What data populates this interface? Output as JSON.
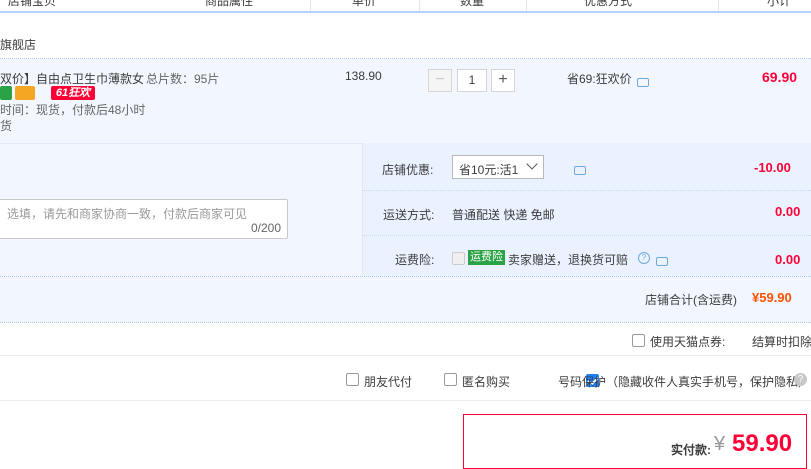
{
  "header": {
    "columns": [
      "店铺宝贝",
      "商品属性",
      "单价",
      "数量",
      "优惠方式",
      "小计"
    ]
  },
  "shop": {
    "name": "旗舰店"
  },
  "item": {
    "title": "双价】自由点卫生巾薄款女...",
    "attr": "总片数：95片",
    "tag_label": "61狂欢",
    "delivery": "时间：现货，付款后48小时",
    "delivery2": "货",
    "price": "138.90",
    "quantity": "1",
    "promo": "省69:狂欢价",
    "subtotal": "69.90"
  },
  "message": {
    "placeholder": "选填，请先和商家协商一致，付款后商家可见",
    "counter": "0/200"
  },
  "shop_discount": {
    "label": "店铺优惠:",
    "selected": "省10元:活1",
    "amount": "-10.00"
  },
  "shipping": {
    "label": "运送方式:",
    "value": "普通配送 快递 免邮",
    "amount": "0.00"
  },
  "insurance": {
    "label": "运费险:",
    "badge": "运费险",
    "text": "卖家赠送，退换货可赔",
    "amount": "0.00"
  },
  "shop_total": {
    "label": "店铺合计(含运费)",
    "amount": "¥59.90"
  },
  "tmall_points": {
    "label": "使用天猫点券:",
    "note": "结算时扣除"
  },
  "options": {
    "friend_pay": "朋友代付",
    "anonymous": "匿名购买",
    "privacy": "号码保护（隐藏收件人真实手机号，保护隐私）"
  },
  "payment": {
    "label": "实付款:",
    "currency": "¥",
    "amount": "59.90"
  },
  "colors": {
    "accent_red": "#ff0036",
    "row_bg": "#f2f7ff",
    "blue_check": "#1b82ff"
  }
}
